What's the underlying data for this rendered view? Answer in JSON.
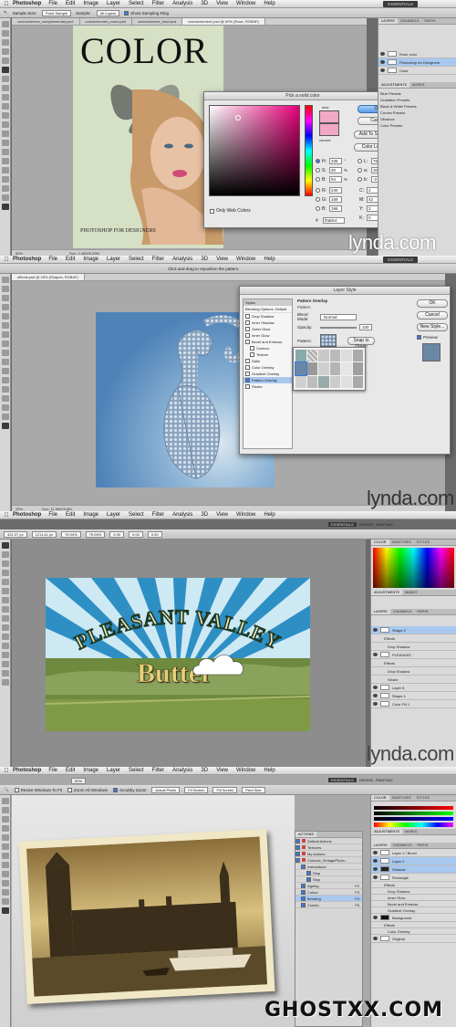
{
  "menu": {
    "app": "Photoshop",
    "items": [
      "File",
      "Edit",
      "Image",
      "Layer",
      "Select",
      "Filter",
      "Analysis",
      "3D",
      "View",
      "Window",
      "Help"
    ]
  },
  "screen1": {
    "workspace": "ESSENTIALS",
    "options": [
      "Sample Size:",
      "Point Sample",
      "Sample:",
      "All Layers",
      "Show Sampling Ring"
    ],
    "tabs": [
      "colorschemes_complementary.psd",
      "colorschemes_mono.psd",
      "colorschemes_triad.psd",
      "colorschemes1.psd @ 50% (Rose, RGB/8*)"
    ],
    "status": "Doc: 2.40M/8.29M",
    "zoom": "50%",
    "poster": {
      "title": "COLOR",
      "footer": "PHOTOSHOP FOR DESIGNERS"
    },
    "picker": {
      "title": "Pick a solid color",
      "ok": "OK",
      "cancel": "Cancel",
      "add": "Add To Swatches",
      "libraries": "Color Libraries",
      "new_label": "new",
      "current_label": "current",
      "web_only": "Only Web Colors",
      "H": "336",
      "S": "30",
      "B": "94",
      "R": "240",
      "G": "168",
      "B2": "196",
      "L": "76",
      "a": "30",
      "b": "-3",
      "C": "2",
      "M": "42",
      "Y": "3",
      "K": "0",
      "hex": "f0a8c4",
      "H_unit": "°",
      "pct": "%"
    },
    "layers": [
      "Rose color",
      "Photoshop for Designers",
      "Color"
    ],
    "layers_tabs": [
      "LAYERS",
      "CHANNELS",
      "PATHS"
    ],
    "color_tabs": [
      "COLOR",
      "SWATCHES",
      "STYLES"
    ],
    "adj_tabs": [
      "ADJUSTMENTS",
      "MASKS"
    ],
    "right_list": [
      "Blue Presets",
      "Gradation Presets",
      "Black & White Presets",
      "Curves Presets",
      "Vibrance",
      "Color Presets"
    ]
  },
  "screen2": {
    "workspace": "ESSENTIALS",
    "hint": "Click and drag to reposition the pattern.",
    "tab": "effects.psd @ 25% (Shapes, RGB/8*)",
    "status": "Doc: 11.9M/29.8M",
    "zoom": "25%",
    "dialog": {
      "title": "Layer Style",
      "styles_header": "Styles",
      "styles": [
        "Blending Options: Default",
        "Drop Shadow",
        "Inner Shadow",
        "Outer Glow",
        "Inner Glow",
        "Bevel and Emboss",
        "Contour",
        "Texture",
        "Satin",
        "Color Overlay",
        "Gradient Overlay",
        "Pattern Overlay",
        "Stroke"
      ],
      "section": "Pattern Overlay",
      "sub": "Pattern",
      "blend_label": "Blend Mode:",
      "blend_value": "Normal",
      "opacity_label": "Opacity:",
      "opacity_value": "100",
      "pattern_label": "Pattern:",
      "snap": "Snap to Origin",
      "ok": "OK",
      "cancel": "Cancel",
      "new_style": "New Style...",
      "preview": "Preview"
    }
  },
  "screen3": {
    "workspace": "ESSENTIALS",
    "ws_extra": [
      "DESIGN",
      "PAINTING"
    ],
    "transform": [
      "421.07 px",
      "1211.41 px",
      "79.04%",
      "79.04%",
      "0.00",
      "0.00",
      "0.00"
    ],
    "art": {
      "line1": "PLEASANT VALLEY",
      "line2": "Butter"
    },
    "layers": [
      "Shape 2",
      "Effects",
      "Drop Shadow",
      "PLEASANT...",
      "Effects",
      "Drop Shadow",
      "Stroke",
      "Layer 8",
      "Shape 1",
      "Color Fill 1"
    ],
    "color_tabs": [
      "COLOR",
      "SWATCHES",
      "STYLES"
    ],
    "adj_tabs": [
      "ADJUSTMENTS",
      "MASKS"
    ],
    "layers_tabs": [
      "LAYERS",
      "CHANNELS",
      "PATHS"
    ]
  },
  "screen4": {
    "workspace": "ESSENTIALS",
    "ws_extra": [
      "DESIGN",
      "PAINTING"
    ],
    "zoom_menu": "50%",
    "options": [
      "Resize Windows To Fit",
      "Zoom All Windows",
      "Scrubby Zoom",
      "Actual Pixels",
      "Fit Screen",
      "Fill Screen",
      "Print Size"
    ],
    "actions_title": "ACTIONS",
    "actions": [
      "Default Actions",
      "Textures",
      "My Actions",
      "Colorize_VintagePhoto...",
      "Instructions",
      "Stop",
      "Stop",
      "Ageing",
      "Colour",
      "Bending",
      "Cracks"
    ],
    "action_keys": [
      "",
      "",
      "",
      "",
      "",
      "",
      "",
      "F2",
      "F3",
      "F4",
      "F5"
    ],
    "layers": [
      "Layer 1 / Bevel",
      "Layer 2",
      "Shadow",
      "Rectangle",
      "Effects",
      "Drop Shadow",
      "Inner Glow",
      "Bevel and Emboss",
      "Gradient Overlay",
      "Background",
      "Effects",
      "Color Overlay",
      "Original"
    ],
    "layers_tabs": [
      "LAYERS",
      "CHANNELS",
      "PATHS"
    ],
    "color_tabs": [
      "COLOR",
      "SWATCHES",
      "STYLES"
    ],
    "adj_tabs": [
      "ADJUSTMENTS",
      "MASKS"
    ]
  },
  "branding": {
    "lynda_1": "lynda.com",
    "lynda_2": "lynda.com",
    "lynda_3": "lynda.com",
    "site": "GHOSTXX.COM"
  }
}
